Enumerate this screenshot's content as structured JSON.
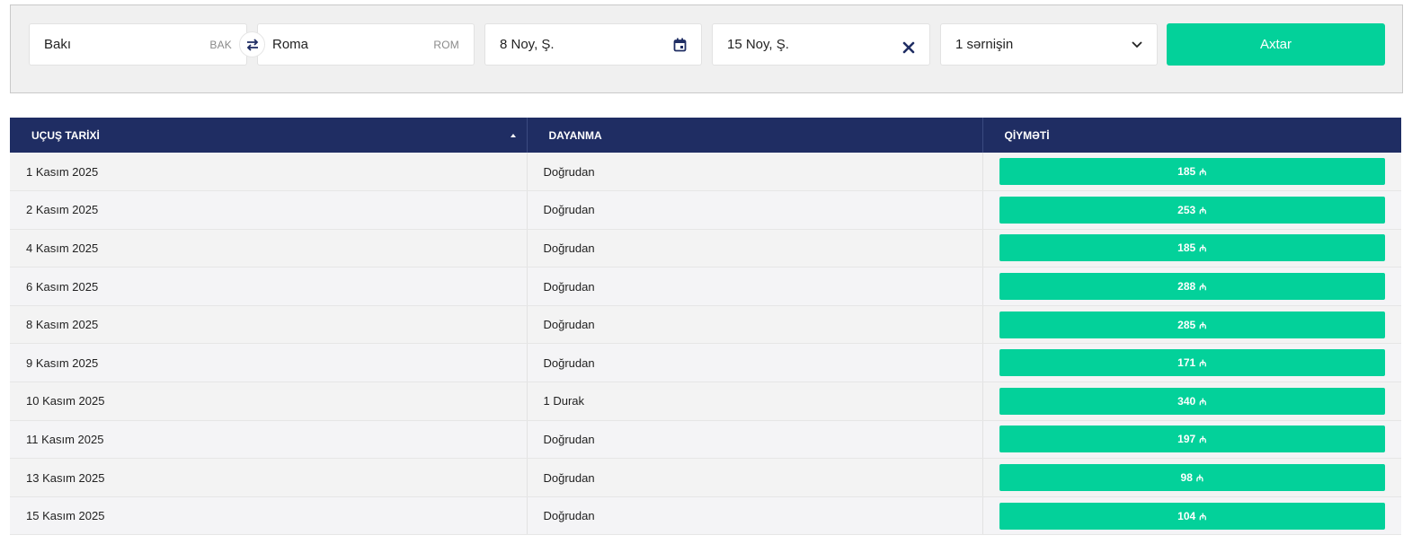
{
  "search": {
    "from_city": "Bakı",
    "from_code": "BAK",
    "to_city": "Roma",
    "to_code": "ROM",
    "depart_date": "8 Noy, Ş.",
    "return_date": "15 Noy, Ş.",
    "passengers": "1 sərnişin",
    "search_label": "Axtar"
  },
  "table": {
    "headers": [
      "UÇUŞ TARİXİ",
      "DAYANMA",
      "QİYMƏTİ"
    ],
    "currency_symbol": "₼",
    "rows": [
      {
        "date": "1 Kasım 2025",
        "stops": "Doğrudan",
        "price": "185"
      },
      {
        "date": "2 Kasım 2025",
        "stops": "Doğrudan",
        "price": "253"
      },
      {
        "date": "4 Kasım 2025",
        "stops": "Doğrudan",
        "price": "185"
      },
      {
        "date": "6 Kasım 2025",
        "stops": "Doğrudan",
        "price": "288"
      },
      {
        "date": "8 Kasım 2025",
        "stops": "Doğrudan",
        "price": "285"
      },
      {
        "date": "9 Kasım 2025",
        "stops": "Doğrudan",
        "price": "171"
      },
      {
        "date": "10 Kasım 2025",
        "stops": "1 Durak",
        "price": "340"
      },
      {
        "date": "11 Kasım 2025",
        "stops": "Doğrudan",
        "price": "197"
      },
      {
        "date": "13 Kasım 2025",
        "stops": "Doğrudan",
        "price": "98"
      },
      {
        "date": "15 Kasım 2025",
        "stops": "Doğrudan",
        "price": "104"
      }
    ]
  },
  "colors": {
    "accent": "#03d19a",
    "header_bg": "#1f2d63"
  },
  "icons": [
    "swap-icon",
    "calendar-icon",
    "close-icon",
    "chevron-down-icon",
    "sort-asc-icon"
  ]
}
